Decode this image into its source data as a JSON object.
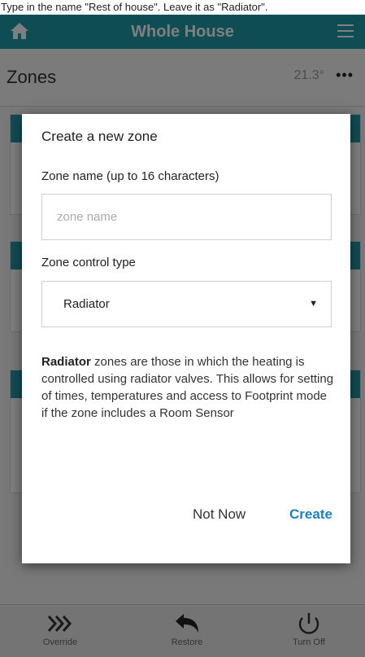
{
  "instruction": "Type in the name \"Rest of house\". Leave it as \"Radiator\".",
  "topbar": {
    "title": "Whole House",
    "home_icon": "home-icon",
    "menu_icon": "hamburger-menu-icon"
  },
  "zones_header": {
    "title": "Zones",
    "temperature": "21.3°",
    "more_icon": "more-horizontal-icon"
  },
  "bottom_bar": {
    "items": [
      {
        "label": "Override",
        "icon": "fast-forward-chevrons-icon"
      },
      {
        "label": "Restore",
        "icon": "undo-arrow-icon"
      },
      {
        "label": "Turn Off",
        "icon": "power-icon"
      }
    ]
  },
  "dialog": {
    "title": "Create a new zone",
    "name_label": "Zone name (up to 16 characters)",
    "name_placeholder": "zone name",
    "name_value": "",
    "control_label": "Zone control type",
    "control_value": "Radiator",
    "description_bold": "Radiator",
    "description_rest": " zones are those in which the heating is controlled using radiator valves. This allows for setting of times, temperatures and access to Footprint mode if the zone includes a Room Sensor",
    "cancel_label": "Not Now",
    "create_label": "Create"
  },
  "colors": {
    "accent": "#1f9aa8",
    "create_button": "#1f7fc1"
  }
}
